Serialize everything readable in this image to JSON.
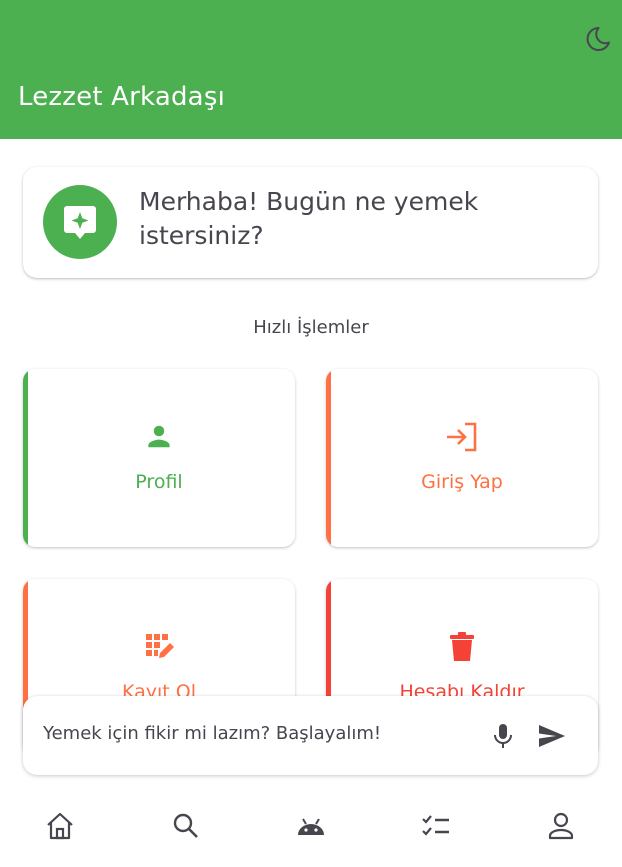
{
  "app": {
    "title": "Lezzet Arkadaşı"
  },
  "greeting": {
    "message": "Merhaba! Bugün ne yemek istersiniz?"
  },
  "quick_actions": {
    "title": "Hızlı İşlemler",
    "items": [
      {
        "label": "Profil",
        "icon": "person-icon",
        "color": "#4caf50"
      },
      {
        "label": "Giriş Yap",
        "icon": "login-icon",
        "color": "#ff7043"
      },
      {
        "label": "Kayıt Ol",
        "icon": "edit-note-icon",
        "color": "#ff7043"
      },
      {
        "label": "Hesabı Kaldır",
        "icon": "trash-icon",
        "color": "#f44336"
      }
    ]
  },
  "chat": {
    "placeholder": "Yemek için fikir mi lazım? Başlayalım!"
  },
  "bottom_nav": [
    "home-icon",
    "search-icon",
    "android-icon",
    "checklist-icon",
    "profile-icon"
  ],
  "colors": {
    "primary": "#4caf50",
    "accent": "#ff7043",
    "danger": "#f44336",
    "text": "#49454f"
  }
}
